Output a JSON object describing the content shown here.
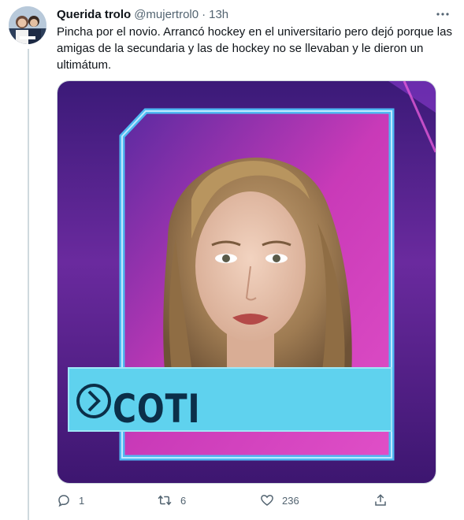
{
  "tweet": {
    "display_name": "Querida trolo",
    "handle": "@mujertrol0",
    "separator": "·",
    "time": "13h",
    "text": "Pincha por el novio. Arrancó hockey en el universitario pero dejó porque las amigas de la secundaria y las de hockey no se llevaban y le dieron un ultimátum.",
    "media": {
      "label": "COTI",
      "icon": "chevron-circle-icon",
      "colors": {
        "frame": "#4fb9f2",
        "label_bar": "#5fd2ee",
        "background_top": "#4a1f8a",
        "background_pink": "#d93ac0",
        "label_text": "#0b2f49"
      }
    }
  },
  "actions": {
    "reply_count": "1",
    "retweet_count": "6",
    "like_count": "236"
  },
  "icons": {
    "more": "more-dots-icon",
    "reply": "reply-icon",
    "retweet": "retweet-icon",
    "like": "heart-icon",
    "share": "share-icon"
  },
  "colors": {
    "secondary_text": "#536471",
    "text": "#0f1419",
    "border": "#cfd9de"
  }
}
